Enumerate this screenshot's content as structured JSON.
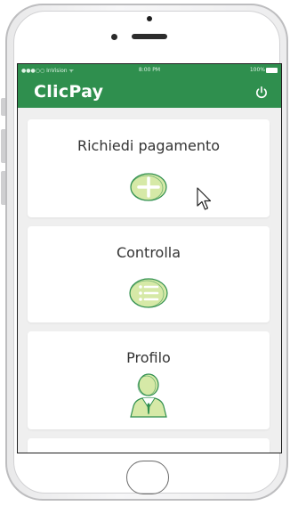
{
  "status_bar": {
    "carrier": "●●●○○ InVision ᯤ",
    "time": "8:00 PM",
    "battery": "100%"
  },
  "app": {
    "title": "ClicPay"
  },
  "cards": [
    {
      "label": "Richiedi pagamento",
      "icon": "plus-circle-icon"
    },
    {
      "label": "Controlla",
      "icon": "list-icon"
    },
    {
      "label": "Profilo",
      "icon": "user-icon"
    }
  ],
  "colors": {
    "brand_green": "#2f8f4e",
    "icon_fill": "#d6e9a7",
    "icon_stroke": "#2f8f4e"
  }
}
